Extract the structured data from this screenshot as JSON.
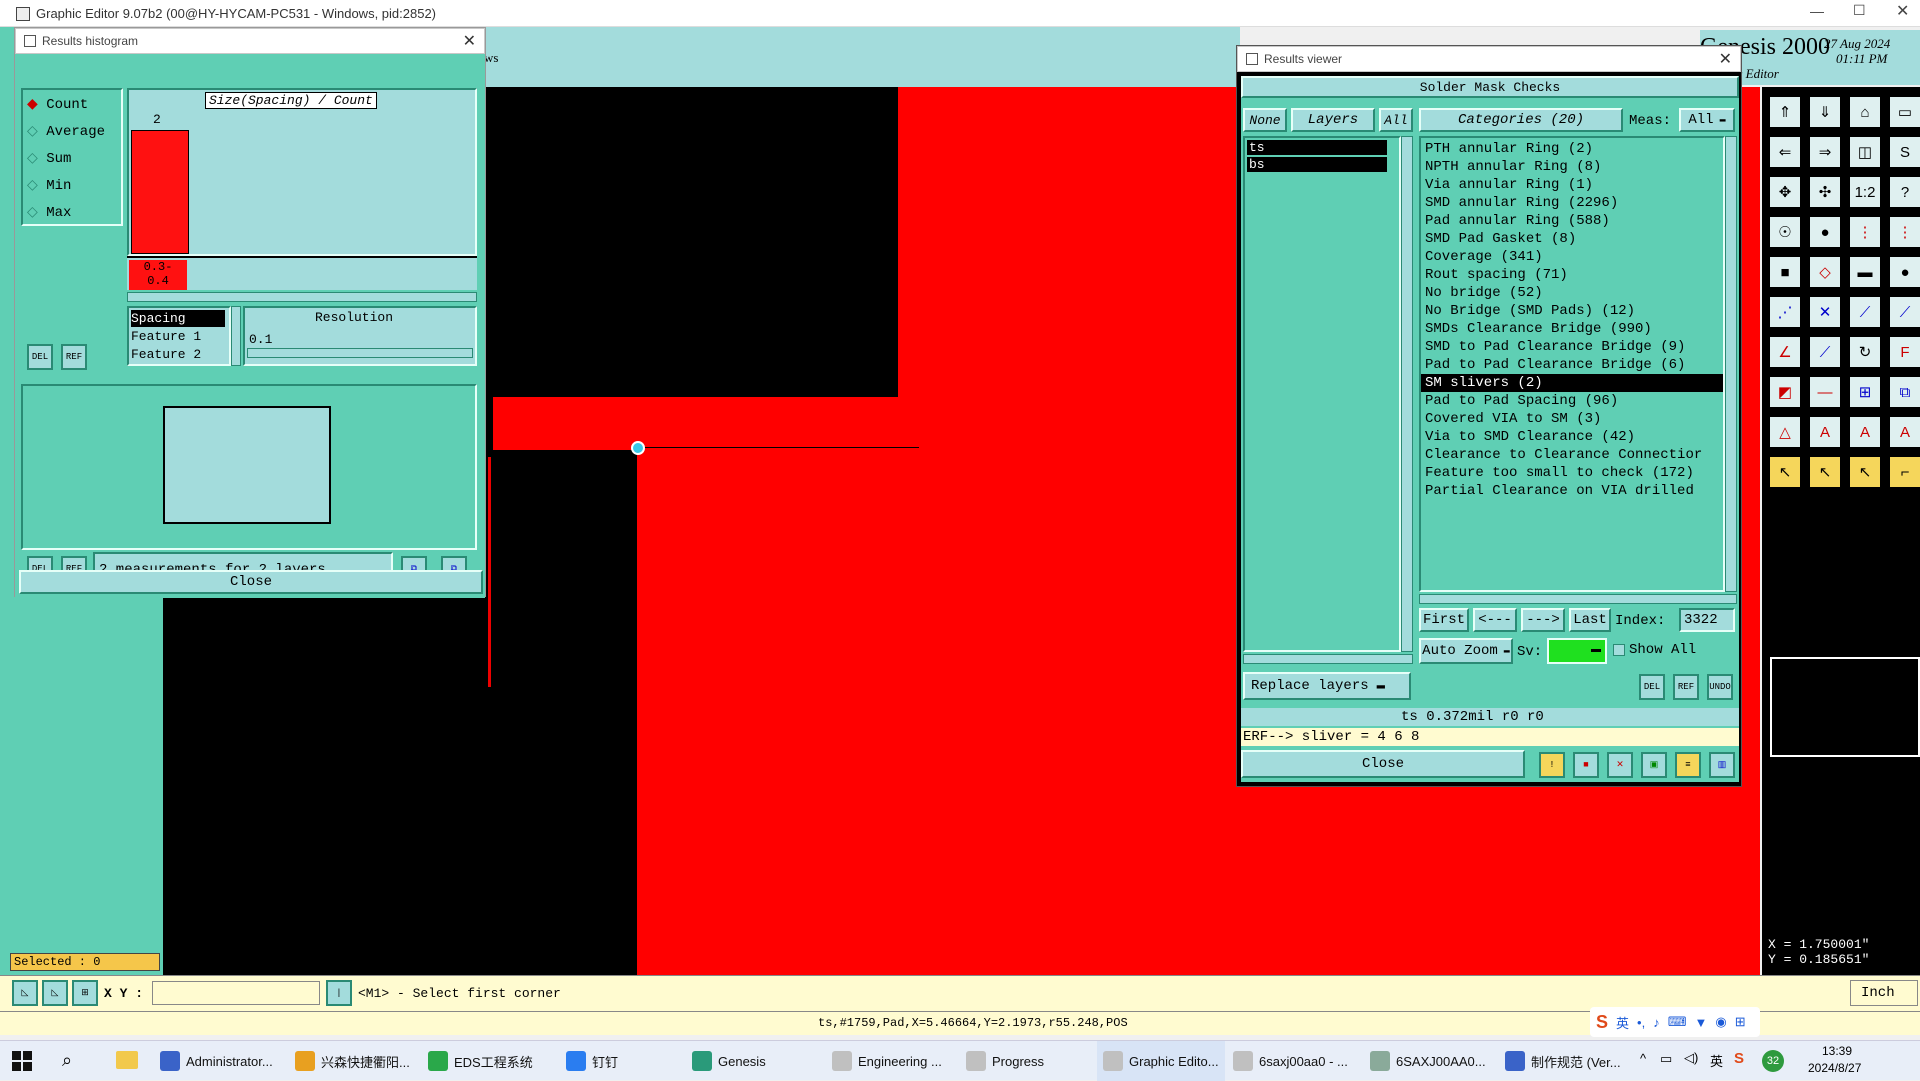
{
  "app": {
    "title": "Graphic Editor 9.07b2 (00@HY-HYCAM-PC531 - Windows, pid:2852)",
    "genesis_label": "Genesis 2000",
    "genesis_sub": "phic Editor",
    "date": "27 Aug 2024",
    "time": "01:11 PM",
    "partial_menu_text": "ws"
  },
  "histogram": {
    "title": "Results histogram",
    "modes": [
      {
        "label": "Count",
        "active": true
      },
      {
        "label": "Average",
        "active": false
      },
      {
        "label": "Sum",
        "active": false
      },
      {
        "label": "Min",
        "active": false
      },
      {
        "label": "Max",
        "active": false
      }
    ],
    "chart_title": "Size(Spacing) / Count",
    "bar_count": "2",
    "bar_range": "0.3-\n0.4",
    "bar_range_line1": "0.3-",
    "bar_range_line2": "0.4",
    "list": [
      "Spacing",
      "Feature 1",
      "Feature 2"
    ],
    "resolution_label": "Resolution",
    "resolution_value": "0.1",
    "measurements": "2 measurements for 2 layers",
    "close": "Close",
    "del": "DEL",
    "ref": "REF"
  },
  "viewer": {
    "title": "Results viewer",
    "header": "Solder Mask Checks",
    "none": "None",
    "layers": "Layers",
    "all": "All",
    "categories": "Categories (20)",
    "meas_label": "Meas:",
    "meas_value": "All",
    "layer_items": [
      "ts",
      "bs"
    ],
    "category_items": [
      "PTH annular Ring (2)",
      "NPTH annular Ring (8)",
      "Via annular Ring (1)",
      "SMD annular Ring (2296)",
      "Pad annular Ring (588)",
      "SMD Pad Gasket (8)",
      "Coverage (341)",
      "Rout spacing (71)",
      "No bridge (52)",
      "No Bridge (SMD Pads) (12)",
      "SMDs Clearance Bridge (990)",
      "SMD to Pad Clearance Bridge (9)",
      "Pad to Pad Clearance Bridge (6)",
      "SM slivers (2)",
      "Pad to Pad Spacing (96)",
      "Covered VIA to SM (3)",
      "Via to SMD Clearance (42)",
      "Clearance to Clearance Connectior",
      "Feature too small to check (172)",
      "Partial Clearance on VIA drilled"
    ],
    "selected_category_index": 13,
    "first": "First",
    "prev": "<---",
    "next": "--->",
    "last": "Last",
    "index_label": "Index:",
    "index_value": "3322",
    "auto_zoom": "Auto Zoom",
    "sv_label": "Sv:",
    "show_all": "Show All",
    "replace_layers": "Replace layers",
    "info_line": "ts 0.372mil  r0  r0",
    "erf_line": "ERF--> sliver = 4 6 8",
    "close": "Close",
    "del": "DEL",
    "ref": "REF",
    "undo": "UNDO"
  },
  "status": {
    "selected": "Selected : 0",
    "xy_label": "X Y :",
    "xy_value": "",
    "prompt": "<M1> - Select first corner",
    "unit": "Inch",
    "coord_x": "X = 1.750001\"",
    "coord_y": "Y = 0.185651\"",
    "feature_info": "ts,#1759,Pad,X=5.46664,Y=2.1973,r55.248,POS"
  },
  "taskbar": {
    "items": [
      {
        "label": "Administrator...",
        "color": "#3a63c8"
      },
      {
        "label": "兴森快捷衢阳...",
        "color": "#e8a020"
      },
      {
        "label": "EDS工程系统",
        "color": "#2aa84a"
      },
      {
        "label": "钉钉",
        "color": "#2a7df0"
      },
      {
        "label": "Genesis",
        "color": "#2a9a7a"
      },
      {
        "label": "Engineering ...",
        "color": "#c0c0c0"
      },
      {
        "label": "Progress",
        "color": "#c0c0c0"
      },
      {
        "label": "Graphic Edito...",
        "color": "#c0c0c0"
      },
      {
        "label": "6saxj00aa0 - ...",
        "color": "#c0c0c0"
      },
      {
        "label": "6SAXJ00AA0...",
        "color": "#8aaa9a"
      },
      {
        "label": "制作规范 (Ver...",
        "color": "#3a63c8"
      }
    ],
    "ime": "英",
    "tray_lang": "英",
    "notif": "32",
    "clock_time": "13:39",
    "clock_date": "2024/8/27"
  }
}
